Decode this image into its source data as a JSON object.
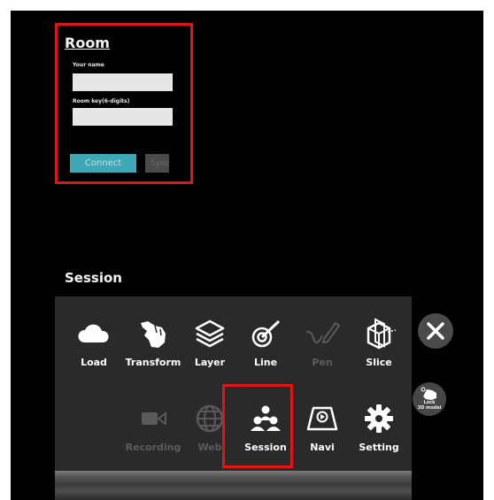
{
  "room": {
    "title": "Room",
    "name_label": "Your name",
    "name_value": "",
    "key_label": "Room key(6-digits)",
    "key_value": "",
    "connect_label": "Connect",
    "sync_label": "Sync"
  },
  "section_heading": "Session",
  "menu": {
    "row1": [
      {
        "label": "Load",
        "icon": "cloud-icon",
        "enabled": true
      },
      {
        "label": "Transform",
        "icon": "hand-icon",
        "enabled": true
      },
      {
        "label": "Layer",
        "icon": "layers-icon",
        "enabled": true
      },
      {
        "label": "Line",
        "icon": "line-target-icon",
        "enabled": true
      },
      {
        "label": "Pen",
        "icon": "pen-icon",
        "enabled": false
      },
      {
        "label": "Slice",
        "icon": "slice-cube-icon",
        "enabled": true
      }
    ],
    "row2": [
      {
        "label": "Recording",
        "icon": "video-camera-icon",
        "enabled": false
      },
      {
        "label": "Web",
        "icon": "globe-icon",
        "enabled": false
      },
      {
        "label": "Session",
        "icon": "users-icon",
        "enabled": true,
        "highlighted": true
      },
      {
        "label": "Navi",
        "icon": "navigation-icon",
        "enabled": true
      },
      {
        "label": "Setting",
        "icon": "gear-icon",
        "enabled": true
      }
    ]
  },
  "side": {
    "close_icon": "close-icon",
    "lock_label_line1": "Lock",
    "lock_label_line2": "3D model"
  },
  "colors": {
    "highlight": "#e01515",
    "connect_button": "#3fa8b6",
    "panel": "#2a2a2a"
  }
}
